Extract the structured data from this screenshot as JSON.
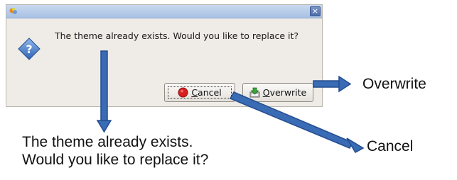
{
  "dialog": {
    "icon": "app-icon",
    "close_label": "×",
    "message": "The theme already exists. Would you like to replace it?",
    "question_icon": "question-diamond-icon",
    "buttons": {
      "cancel": {
        "prefix": "",
        "mnemonic": "C",
        "rest": "ancel",
        "icon": "stop-red-icon"
      },
      "overwrite": {
        "prefix": "",
        "mnemonic": "O",
        "rest": "verwrite",
        "icon": "save-green-arrow-icon"
      }
    }
  },
  "annotations": {
    "overwrite": "Overwrite",
    "cancel": "Cancel",
    "message_line1": "The theme already exists.",
    "message_line2": "Would you like to replace it?"
  },
  "colors": {
    "arrow": "#3a6cb5",
    "arrow_border": "#234d8f",
    "dialog_bg": "#efebe7",
    "titlebar": "#a8c1e3"
  }
}
